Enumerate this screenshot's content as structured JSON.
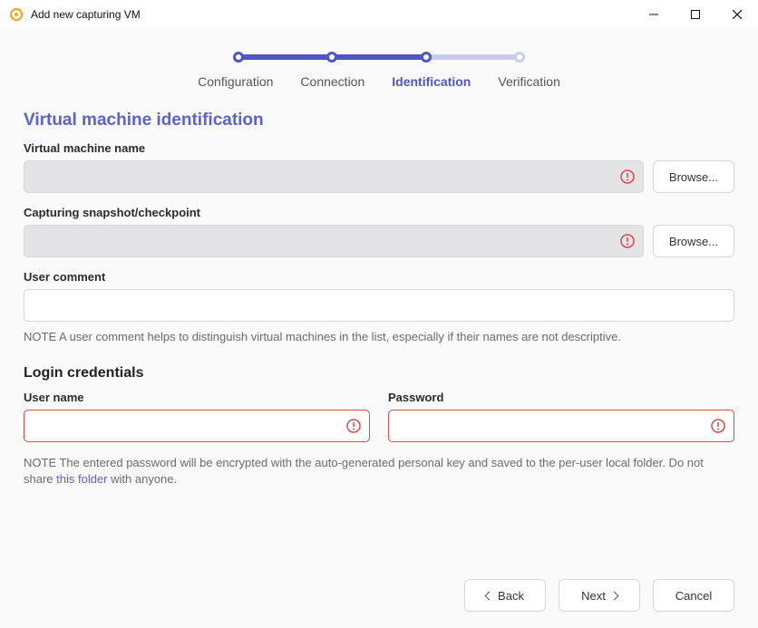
{
  "window": {
    "title": "Add new capturing VM"
  },
  "stepper": {
    "labels": [
      "Configuration",
      "Connection",
      "Identification",
      "Verification"
    ],
    "current_index": 2
  },
  "section_vm": {
    "heading": "Virtual machine identification",
    "name_label": "Virtual machine name",
    "name_value": "",
    "snapshot_label": "Capturing snapshot/checkpoint",
    "snapshot_value": "",
    "browse_label": "Browse...",
    "comment_label": "User comment",
    "comment_value": "",
    "comment_note": "NOTE A user comment helps to distinguish virtual machines in the list, especially if their names are not descriptive."
  },
  "section_login": {
    "heading": "Login credentials",
    "username_label": "User name",
    "username_value": "",
    "password_label": "Password",
    "password_value": "",
    "note_prefix": "NOTE The entered password will be encrypted with the auto-generated personal key and saved to the per-user local folder. Do not share ",
    "note_link": "this folder",
    "note_suffix": " with anyone."
  },
  "footer": {
    "back": "Back",
    "next": "Next",
    "cancel": "Cancel"
  }
}
